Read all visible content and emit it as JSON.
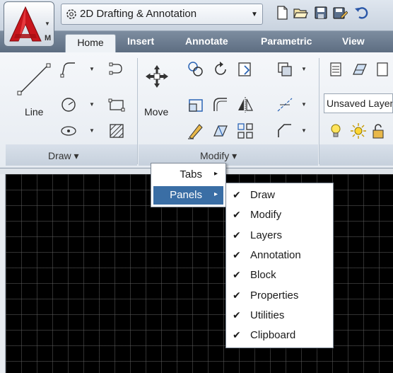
{
  "workspace": {
    "name": "2D Drafting & Annotation"
  },
  "app_button": {
    "letter": "M"
  },
  "tabs": [
    "Home",
    "Insert",
    "Annotate",
    "Parametric",
    "View"
  ],
  "ribbon": {
    "draw_panel": {
      "title": "Draw",
      "line_label": "Line"
    },
    "modify_panel": {
      "title": "Modify",
      "move_label": "Move"
    },
    "layers_panel": {
      "layer_value": "Unsaved Layer State"
    }
  },
  "context_menu": {
    "items": [
      {
        "label": "Tabs",
        "arrow": "▸"
      },
      {
        "label": "Panels",
        "arrow": "▸"
      }
    ]
  },
  "panels_submenu": {
    "check": "✔",
    "items": [
      "Draw",
      "Modify",
      "Layers",
      "Annotation",
      "Block",
      "Properties",
      "Utilities",
      "Clipboard"
    ]
  },
  "colors": {
    "highlight": "#3a6ea5",
    "tab_bar": "#6b7b8f",
    "canvas": "#000000",
    "logo_red": "#c8161d"
  },
  "icons": [
    "gear-icon",
    "new-icon",
    "open-icon",
    "save-icon",
    "save-as-icon",
    "line-icon",
    "polyline-icon",
    "circle-icon",
    "arc-icon",
    "rectangle-icon",
    "hatch-icon",
    "ellipse-icon",
    "move-icon"
  ]
}
